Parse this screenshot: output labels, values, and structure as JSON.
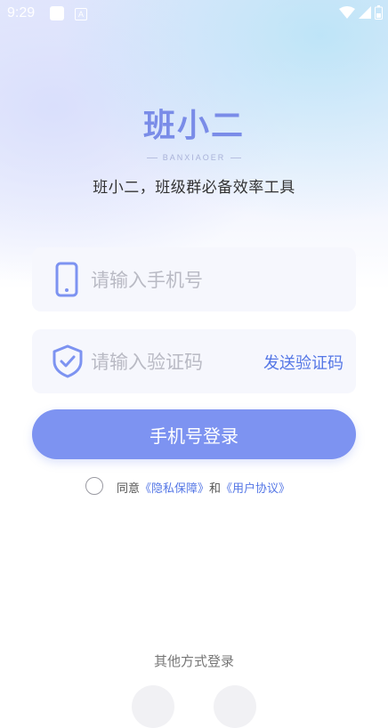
{
  "status_bar": {
    "time": "9:29",
    "notif_badge": "A"
  },
  "logo": {
    "text": "班小二",
    "subtitle": "BANXIAOER"
  },
  "slogan": "班小二，班级群必备效率工具",
  "phone_field": {
    "placeholder": "请输入手机号",
    "value": ""
  },
  "code_field": {
    "placeholder": "请输入验证码",
    "value": "",
    "send_code_label": "发送验证码"
  },
  "login_button": "手机号登录",
  "agreement": {
    "prefix": "同意",
    "privacy_link": "《隐私保障》",
    "and": "和",
    "terms_link": "《用户协议》",
    "checked": false
  },
  "other_login": {
    "label": "其他方式登录"
  },
  "colors": {
    "primary": "#7d93f1",
    "link": "#5577e6",
    "logo": "#7a8ce8"
  }
}
